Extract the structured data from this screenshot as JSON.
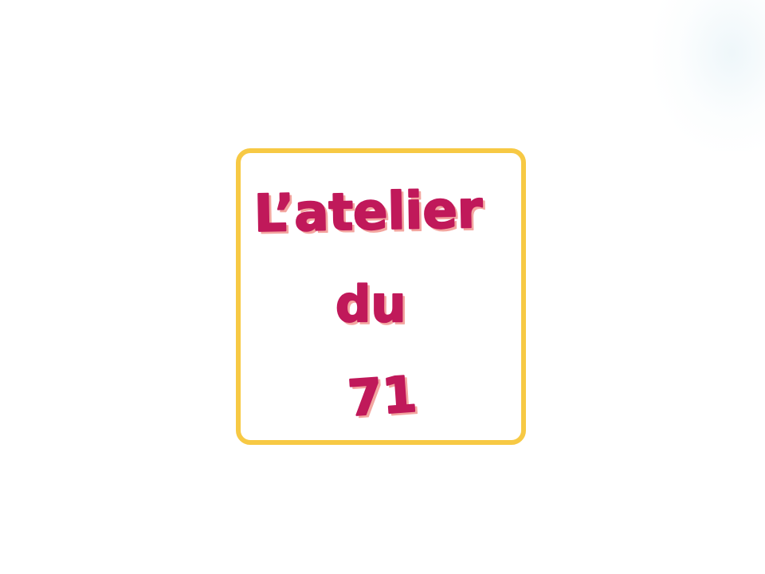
{
  "logo": {
    "line1": "L’atelier",
    "line2": "du",
    "line3": "71",
    "text_color": "#c0195a",
    "frame_color": "#f7c944",
    "shadow_color": "#f3a6a0"
  }
}
